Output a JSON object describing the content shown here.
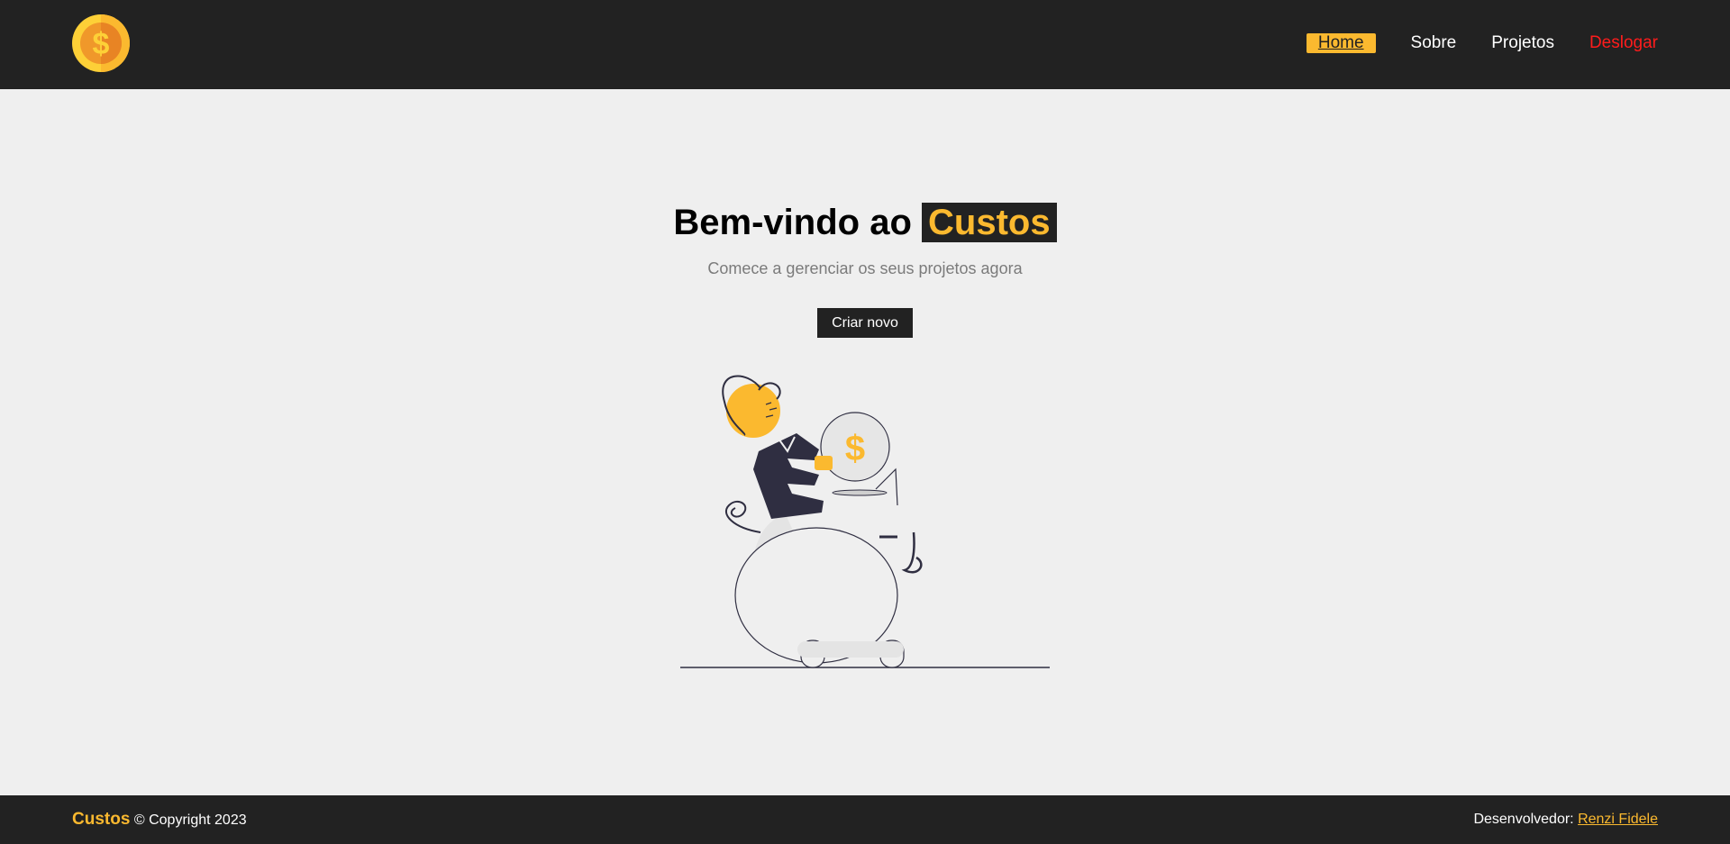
{
  "navbar": {
    "logo_icon": "dollar-coin-icon",
    "links": [
      {
        "label": "Home",
        "active": true
      },
      {
        "label": "Sobre"
      },
      {
        "label": "Projetos"
      },
      {
        "label": "Deslogar"
      }
    ]
  },
  "hero": {
    "title_prefix": "Bem-vindo ao",
    "title_brand": "Custos",
    "subtitle": "Comece a gerenciar os seus projetos agora",
    "cta_label": "Criar novo",
    "illustration_icon": "piggy-bank-savings-icon",
    "coin_symbol": "$"
  },
  "footer": {
    "brand": "Custos",
    "copyright": "© Copyright 2023",
    "developer_label": "Desenvolvedor:",
    "developer_name": "Renzi Fidele"
  },
  "colors": {
    "navbar_bg": "#222222",
    "accent": "#fbb92f",
    "logout": "#ff1c1c",
    "page_bg": "#efefef",
    "subtitle": "#7b7b7b"
  }
}
